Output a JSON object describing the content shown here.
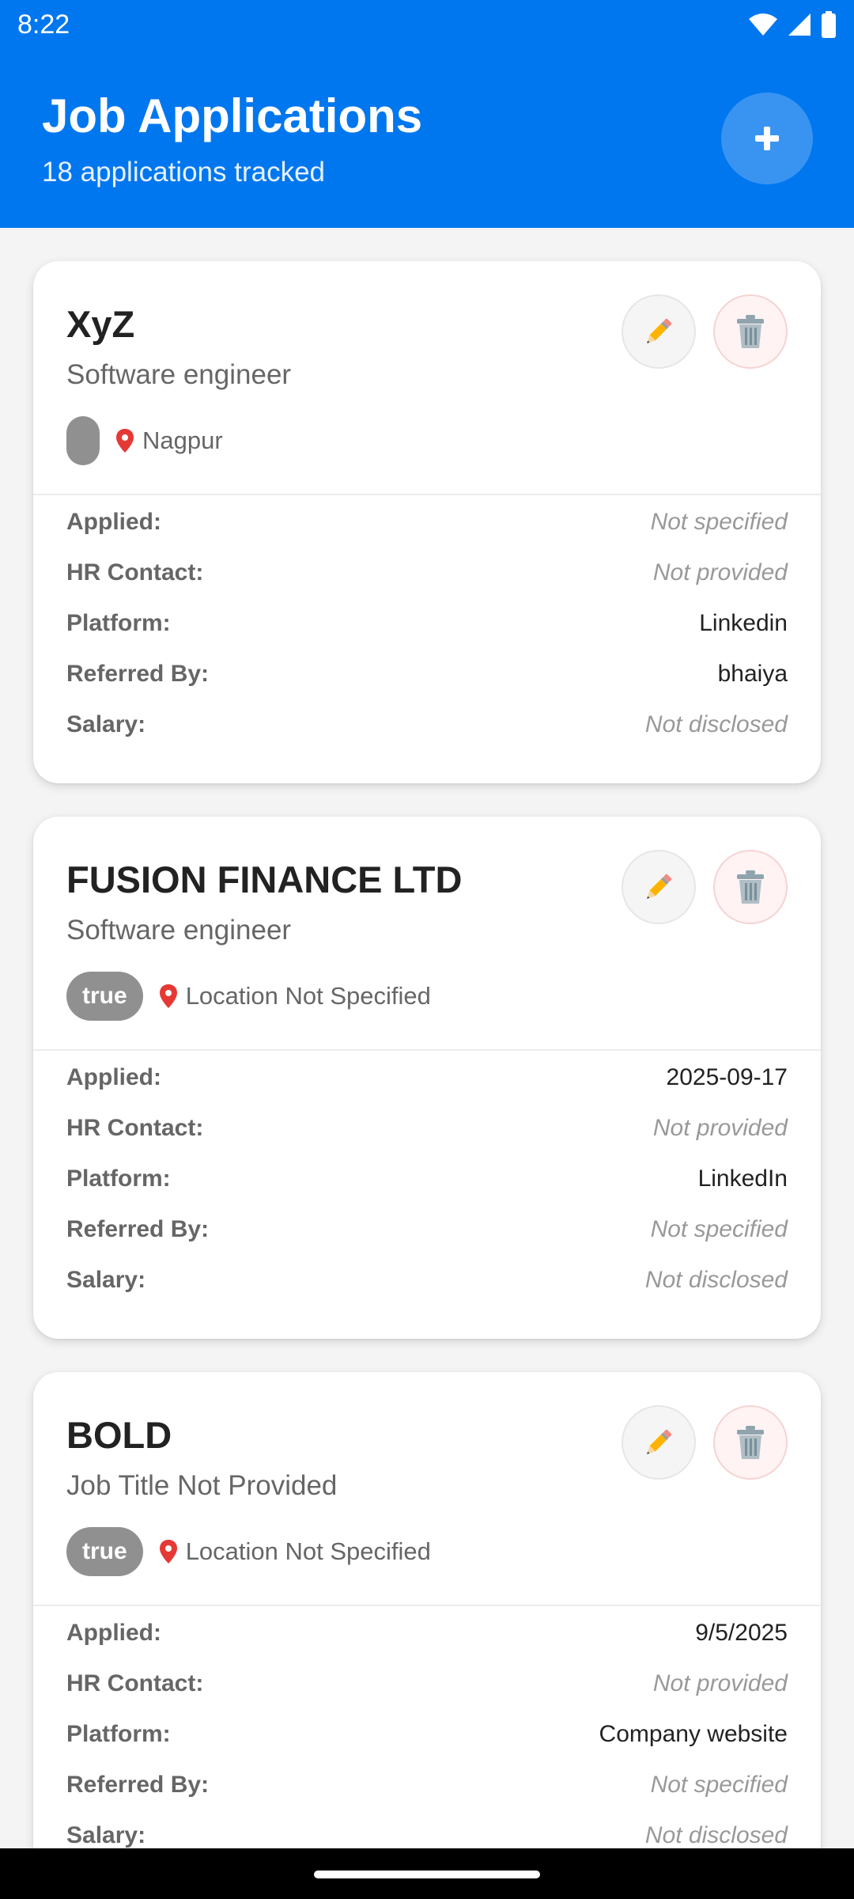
{
  "status_bar": {
    "time": "8:22"
  },
  "header": {
    "title": "Job Applications",
    "subtitle": "18 applications tracked",
    "add_label": "+"
  },
  "labels": {
    "applied": "Applied:",
    "hr_contact": "HR Contact:",
    "platform": "Platform:",
    "referred_by": "Referred By:",
    "salary": "Salary:"
  },
  "cards": [
    {
      "company": "XyZ",
      "job_title": "Software engineer",
      "status": "",
      "location": "Nagpur",
      "applied": "Not specified",
      "hr_contact": "Not provided",
      "platform": "Linkedin",
      "referred_by": "bhaiya",
      "salary": "Not disclosed"
    },
    {
      "company": "FUSION FINANCE LTD",
      "job_title": "Software engineer",
      "status": "true",
      "location": "Location Not Specified",
      "applied": "2025-09-17",
      "hr_contact": "Not provided",
      "platform": "LinkedIn",
      "referred_by": "Not specified",
      "salary": "Not disclosed"
    },
    {
      "company": "BOLD",
      "job_title": "Job Title Not Provided",
      "status": "true",
      "location": "Location Not Specified",
      "applied": "9/5/2025",
      "hr_contact": "Not provided",
      "platform": "Company website",
      "referred_by": "Not specified",
      "salary": "Not disclosed"
    }
  ],
  "colors": {
    "header_bg": "#0077ee",
    "add_button_bg": "#3994f1",
    "badge_bg": "#909090",
    "pin_red": "#e53935"
  }
}
